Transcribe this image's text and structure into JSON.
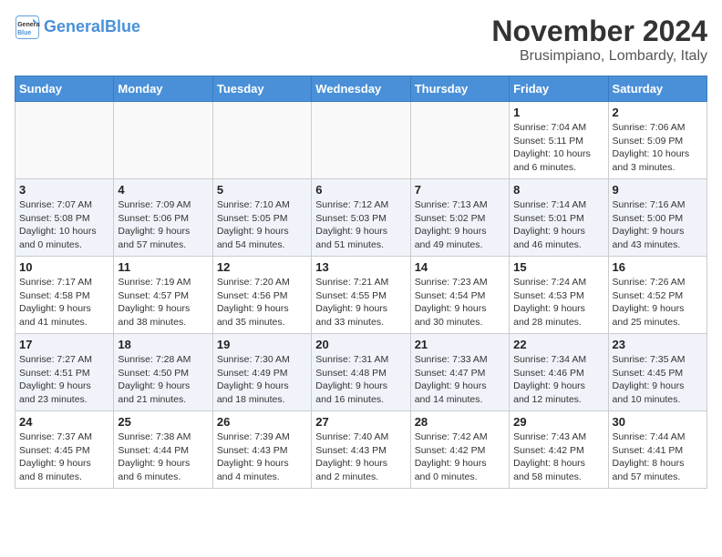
{
  "header": {
    "logo_line1": "General",
    "logo_line2": "Blue",
    "month": "November 2024",
    "location": "Brusimpiano, Lombardy, Italy"
  },
  "weekdays": [
    "Sunday",
    "Monday",
    "Tuesday",
    "Wednesday",
    "Thursday",
    "Friday",
    "Saturday"
  ],
  "weeks": [
    [
      {
        "day": "",
        "info": ""
      },
      {
        "day": "",
        "info": ""
      },
      {
        "day": "",
        "info": ""
      },
      {
        "day": "",
        "info": ""
      },
      {
        "day": "",
        "info": ""
      },
      {
        "day": "1",
        "info": "Sunrise: 7:04 AM\nSunset: 5:11 PM\nDaylight: 10 hours\nand 6 minutes."
      },
      {
        "day": "2",
        "info": "Sunrise: 7:06 AM\nSunset: 5:09 PM\nDaylight: 10 hours\nand 3 minutes."
      }
    ],
    [
      {
        "day": "3",
        "info": "Sunrise: 7:07 AM\nSunset: 5:08 PM\nDaylight: 10 hours\nand 0 minutes."
      },
      {
        "day": "4",
        "info": "Sunrise: 7:09 AM\nSunset: 5:06 PM\nDaylight: 9 hours\nand 57 minutes."
      },
      {
        "day": "5",
        "info": "Sunrise: 7:10 AM\nSunset: 5:05 PM\nDaylight: 9 hours\nand 54 minutes."
      },
      {
        "day": "6",
        "info": "Sunrise: 7:12 AM\nSunset: 5:03 PM\nDaylight: 9 hours\nand 51 minutes."
      },
      {
        "day": "7",
        "info": "Sunrise: 7:13 AM\nSunset: 5:02 PM\nDaylight: 9 hours\nand 49 minutes."
      },
      {
        "day": "8",
        "info": "Sunrise: 7:14 AM\nSunset: 5:01 PM\nDaylight: 9 hours\nand 46 minutes."
      },
      {
        "day": "9",
        "info": "Sunrise: 7:16 AM\nSunset: 5:00 PM\nDaylight: 9 hours\nand 43 minutes."
      }
    ],
    [
      {
        "day": "10",
        "info": "Sunrise: 7:17 AM\nSunset: 4:58 PM\nDaylight: 9 hours\nand 41 minutes."
      },
      {
        "day": "11",
        "info": "Sunrise: 7:19 AM\nSunset: 4:57 PM\nDaylight: 9 hours\nand 38 minutes."
      },
      {
        "day": "12",
        "info": "Sunrise: 7:20 AM\nSunset: 4:56 PM\nDaylight: 9 hours\nand 35 minutes."
      },
      {
        "day": "13",
        "info": "Sunrise: 7:21 AM\nSunset: 4:55 PM\nDaylight: 9 hours\nand 33 minutes."
      },
      {
        "day": "14",
        "info": "Sunrise: 7:23 AM\nSunset: 4:54 PM\nDaylight: 9 hours\nand 30 minutes."
      },
      {
        "day": "15",
        "info": "Sunrise: 7:24 AM\nSunset: 4:53 PM\nDaylight: 9 hours\nand 28 minutes."
      },
      {
        "day": "16",
        "info": "Sunrise: 7:26 AM\nSunset: 4:52 PM\nDaylight: 9 hours\nand 25 minutes."
      }
    ],
    [
      {
        "day": "17",
        "info": "Sunrise: 7:27 AM\nSunset: 4:51 PM\nDaylight: 9 hours\nand 23 minutes."
      },
      {
        "day": "18",
        "info": "Sunrise: 7:28 AM\nSunset: 4:50 PM\nDaylight: 9 hours\nand 21 minutes."
      },
      {
        "day": "19",
        "info": "Sunrise: 7:30 AM\nSunset: 4:49 PM\nDaylight: 9 hours\nand 18 minutes."
      },
      {
        "day": "20",
        "info": "Sunrise: 7:31 AM\nSunset: 4:48 PM\nDaylight: 9 hours\nand 16 minutes."
      },
      {
        "day": "21",
        "info": "Sunrise: 7:33 AM\nSunset: 4:47 PM\nDaylight: 9 hours\nand 14 minutes."
      },
      {
        "day": "22",
        "info": "Sunrise: 7:34 AM\nSunset: 4:46 PM\nDaylight: 9 hours\nand 12 minutes."
      },
      {
        "day": "23",
        "info": "Sunrise: 7:35 AM\nSunset: 4:45 PM\nDaylight: 9 hours\nand 10 minutes."
      }
    ],
    [
      {
        "day": "24",
        "info": "Sunrise: 7:37 AM\nSunset: 4:45 PM\nDaylight: 9 hours\nand 8 minutes."
      },
      {
        "day": "25",
        "info": "Sunrise: 7:38 AM\nSunset: 4:44 PM\nDaylight: 9 hours\nand 6 minutes."
      },
      {
        "day": "26",
        "info": "Sunrise: 7:39 AM\nSunset: 4:43 PM\nDaylight: 9 hours\nand 4 minutes."
      },
      {
        "day": "27",
        "info": "Sunrise: 7:40 AM\nSunset: 4:43 PM\nDaylight: 9 hours\nand 2 minutes."
      },
      {
        "day": "28",
        "info": "Sunrise: 7:42 AM\nSunset: 4:42 PM\nDaylight: 9 hours\nand 0 minutes."
      },
      {
        "day": "29",
        "info": "Sunrise: 7:43 AM\nSunset: 4:42 PM\nDaylight: 8 hours\nand 58 minutes."
      },
      {
        "day": "30",
        "info": "Sunrise: 7:44 AM\nSunset: 4:41 PM\nDaylight: 8 hours\nand 57 minutes."
      }
    ]
  ]
}
